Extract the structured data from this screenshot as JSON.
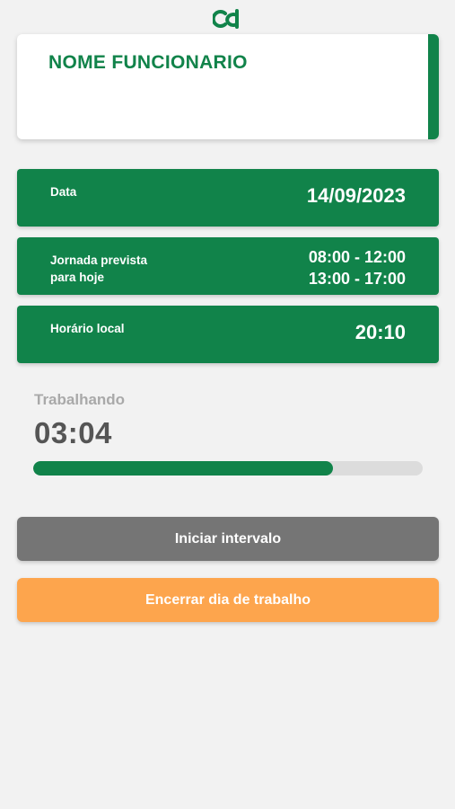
{
  "app": {
    "logo_icon": "cd-logo-icon",
    "brand_color": "#11834a"
  },
  "employee": {
    "name": "NOME FUNCIONARIO"
  },
  "date_card": {
    "label": "Data",
    "value": "14/09/2023"
  },
  "schedule_card": {
    "label_line1": "Jornada prevista",
    "label_line2": "para hoje",
    "shift1": "08:00 - 12:00",
    "shift2": "13:00 - 17:00"
  },
  "local_time_card": {
    "label": "Horário local",
    "value": "20:10"
  },
  "work": {
    "status": "Trabalhando",
    "elapsed": "03:04",
    "progress_fraction": 0.77
  },
  "actions": {
    "start_break_label": "Iniciar intervalo",
    "end_day_label": "Encerrar dia de trabalho",
    "start_break_color": "#757575",
    "end_day_color": "#fda54d"
  }
}
